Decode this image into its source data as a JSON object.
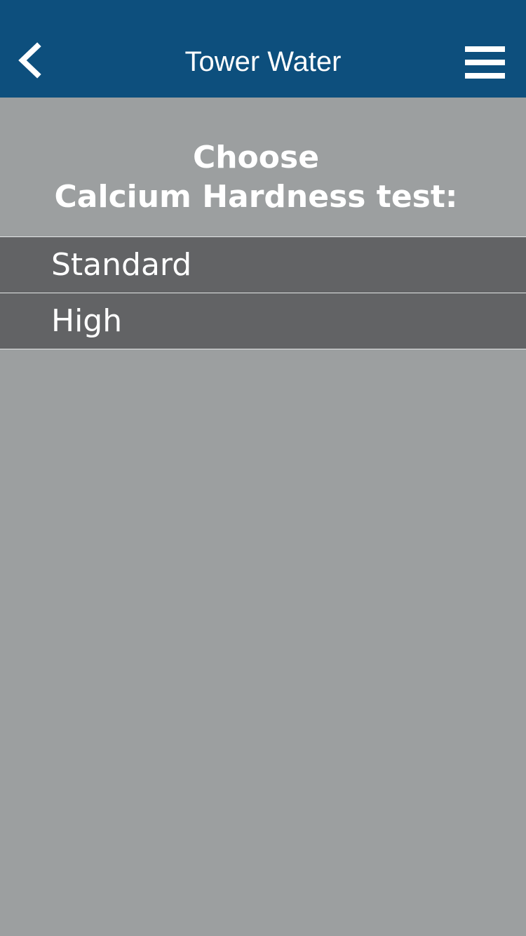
{
  "header": {
    "title": "Tower Water",
    "back_icon": "chevron-left-icon",
    "menu_icon": "hamburger-menu-icon"
  },
  "prompt": {
    "line1": "Choose",
    "line2": "Calcium Hardness test:"
  },
  "options": [
    {
      "label": "Standard"
    },
    {
      "label": "High"
    }
  ],
  "colors": {
    "header_background": "#0d4f7d",
    "page_background": "#9c9fa0",
    "option_background": "#626365",
    "divider": "#e4e6e7",
    "text": "#ffffff"
  }
}
